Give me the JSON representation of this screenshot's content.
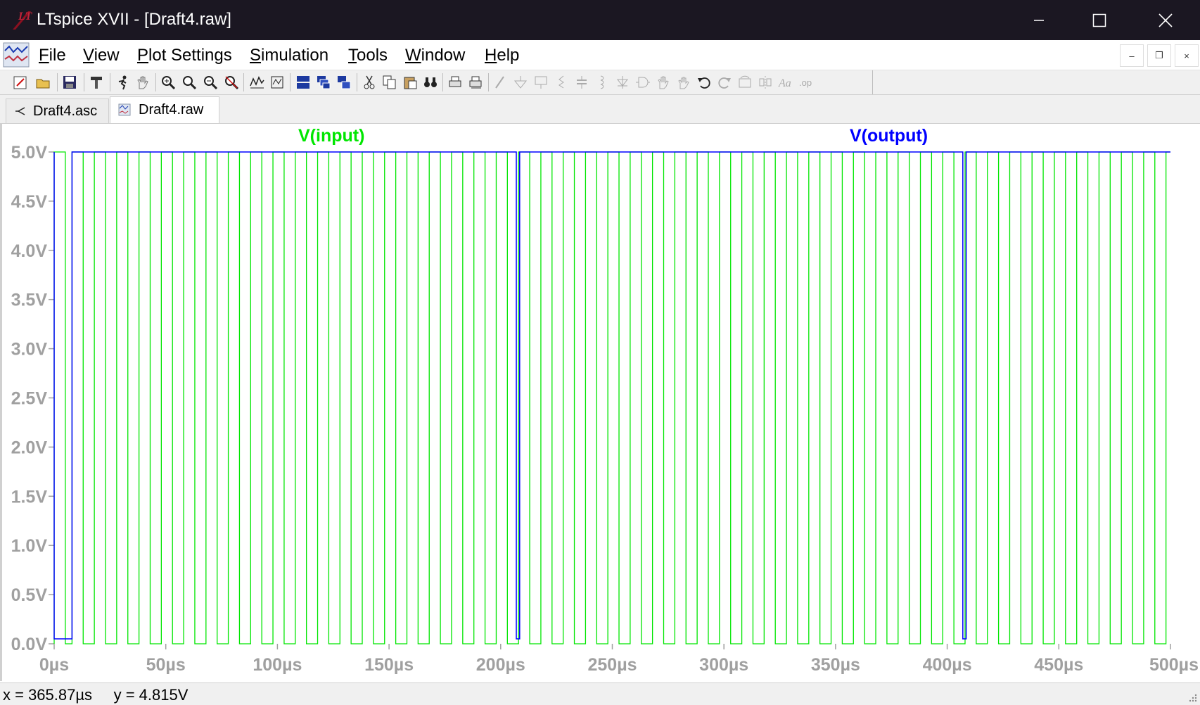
{
  "window": {
    "title": "LTspice XVII - [Draft4.raw]"
  },
  "menu": [
    {
      "label": "File",
      "accel": "F",
      "rest": "ile"
    },
    {
      "label": "View",
      "accel": "V",
      "rest": "iew"
    },
    {
      "label": "Plot Settings",
      "accel": "P",
      "rest": "lot Settings"
    },
    {
      "label": "Simulation",
      "accel": "S",
      "rest": "imulation"
    },
    {
      "label": "Tools",
      "accel": "T",
      "rest": "ools"
    },
    {
      "label": "Window",
      "accel": "W",
      "rest": "indow"
    },
    {
      "label": "Help",
      "accel": "H",
      "rest": "elp"
    }
  ],
  "tabs": [
    {
      "label": "Draft4.asc",
      "icon": "schematic-icon",
      "active": false
    },
    {
      "label": "Draft4.raw",
      "icon": "waveform-icon",
      "active": true
    }
  ],
  "status": {
    "x_readout": "x = 365.87µs",
    "y_readout": "y = 4.815V"
  },
  "colors": {
    "input_trace": "#00e600",
    "output_trace": "#0000ff",
    "axis_text": "#a0a0a0",
    "titlebar": "#1b1722"
  },
  "chart_data": {
    "type": "line",
    "xlim": [
      0,
      500
    ],
    "ylim": [
      0,
      5
    ],
    "x_unit": "µs",
    "x_ticks": [
      "0µs",
      "50µs",
      "100µs",
      "150µs",
      "200µs",
      "250µs",
      "300µs",
      "350µs",
      "400µs",
      "450µs",
      "500µs"
    ],
    "y_ticks": [
      "0.0V",
      "0.5V",
      "1.0V",
      "1.5V",
      "2.0V",
      "2.5V",
      "3.0V",
      "3.5V",
      "4.0V",
      "4.5V",
      "5.0V"
    ],
    "grid": false,
    "series": [
      {
        "name": "V(input)",
        "color": "#00e600",
        "waveform": "square",
        "low": 0,
        "high": 5,
        "period_us": 10,
        "duty": 0.5,
        "first_rise_us": 0,
        "segment_starts_us": [
          0,
          8,
          208,
          408
        ],
        "segment_ends_us": [
          8,
          208,
          408,
          500
        ]
      },
      {
        "name": "V(output)",
        "color": "#0000ff",
        "x": [
          0,
          0,
          8,
          8,
          207,
          207,
          208.5,
          208.5,
          407,
          407,
          408.5,
          408.5,
          500
        ],
        "y": [
          5,
          0.05,
          0.05,
          5,
          5,
          0.05,
          0.05,
          5,
          5,
          0.05,
          0.05,
          5,
          5
        ]
      }
    ]
  }
}
